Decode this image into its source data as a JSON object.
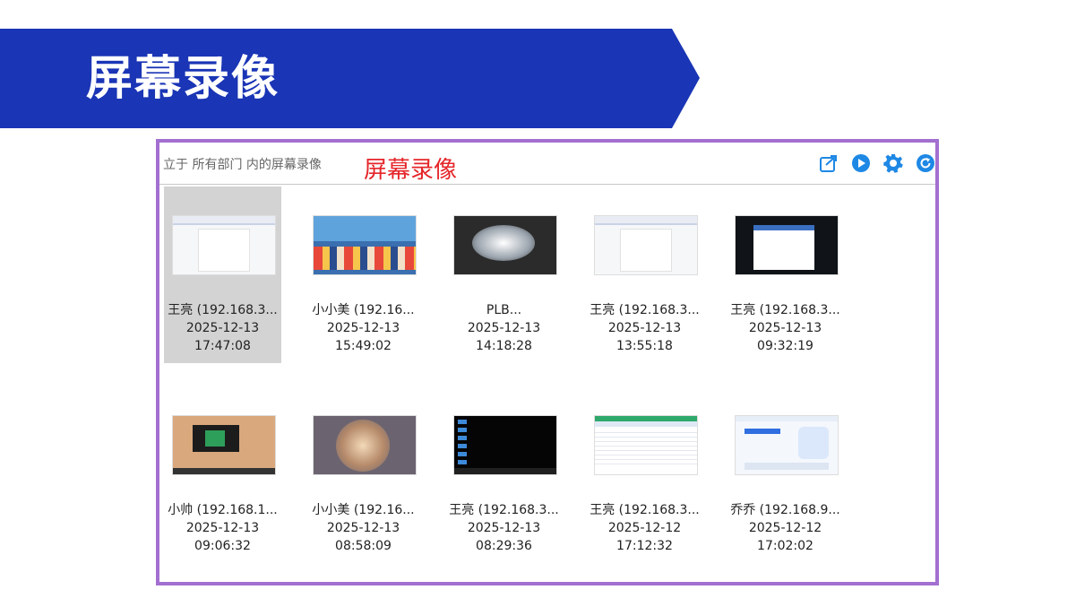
{
  "banner": {
    "title": "屏幕录像",
    "color": "#1a35b5"
  },
  "panel": {
    "breadcrumb": "立于 所有部门 内的屏幕录像",
    "annotation": "屏幕录像",
    "border_color": "#a36fd0",
    "toolbar_icons": [
      "export-icon",
      "play-icon",
      "settings-gear-icon",
      "refresh-icon"
    ]
  },
  "recordings": [
    {
      "name": "王亮 (192.168.3...",
      "date": "2025-12-13",
      "time": "17:47:08",
      "selected": true,
      "thumb": "document-window"
    },
    {
      "name": "小小美 (192.16...",
      "date": "2025-12-13",
      "time": "15:49:02",
      "selected": false,
      "thumb": "cartoon-desktop"
    },
    {
      "name": "PLB...",
      "date": "2025-12-13",
      "time": "14:18:28",
      "selected": false,
      "thumb": "ice-photo"
    },
    {
      "name": "王亮 (192.168.3...",
      "date": "2025-12-13",
      "time": "13:55:18",
      "selected": false,
      "thumb": "document-window"
    },
    {
      "name": "王亮 (192.168.3...",
      "date": "2025-12-13",
      "time": "09:32:19",
      "selected": false,
      "thumb": "dark-desktop-app"
    },
    {
      "name": "小帅 (192.168.1...",
      "date": "2025-12-13",
      "time": "09:06:32",
      "selected": false,
      "thumb": "beige-desktop"
    },
    {
      "name": "小小美 (192.16...",
      "date": "2025-12-13",
      "time": "08:58:09",
      "selected": false,
      "thumb": "cartoon-art"
    },
    {
      "name": "王亮 (192.168.3...",
      "date": "2025-12-13",
      "time": "08:29:36",
      "selected": false,
      "thumb": "dark-desktop"
    },
    {
      "name": "王亮 (192.168.3...",
      "date": "2025-12-12",
      "time": "17:12:32",
      "selected": false,
      "thumb": "spreadsheet-window"
    },
    {
      "name": "乔乔 (192.168.9...",
      "date": "2025-12-12",
      "time": "17:02:02",
      "selected": false,
      "thumb": "web-page"
    }
  ]
}
